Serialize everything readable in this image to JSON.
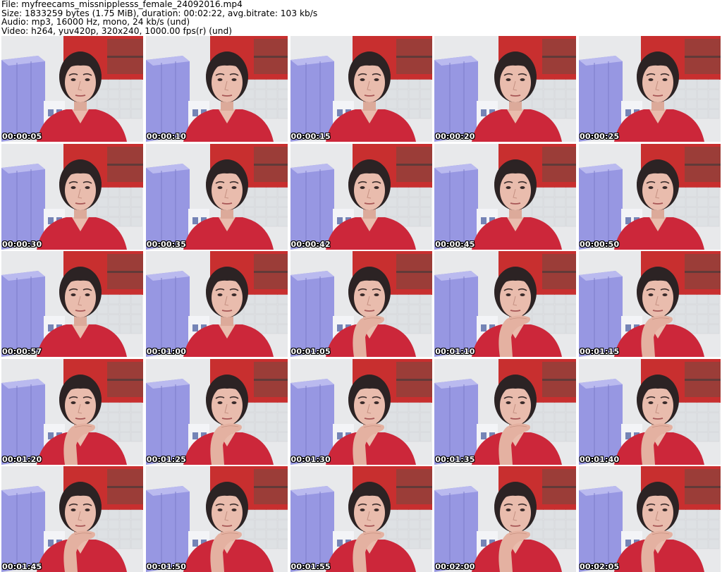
{
  "header": {
    "file_line": "File: myfreecams_missnipplesss_female_24092016.mp4",
    "size_line": "Size: 1833259 bytes (1.75 MiB), duration: 00:02:22, avg.bitrate: 103 kb/s",
    "audio_line": "Audio: mp3, 16000 Hz, mono, 24 kb/s (und)",
    "video_line": "Video: h264, yuv420p, 320x240, 1000.00 fps(r) (und)"
  },
  "thumbnails": [
    {
      "timestamp": "00:00:05",
      "pose": "neutral"
    },
    {
      "timestamp": "00:00:10",
      "pose": "neutral"
    },
    {
      "timestamp": "00:00:15",
      "pose": "neutral"
    },
    {
      "timestamp": "00:00:20",
      "pose": "neutral"
    },
    {
      "timestamp": "00:00:25",
      "pose": "neutral"
    },
    {
      "timestamp": "00:00:30",
      "pose": "neutral"
    },
    {
      "timestamp": "00:00:35",
      "pose": "neutral"
    },
    {
      "timestamp": "00:00:42",
      "pose": "neutral"
    },
    {
      "timestamp": "00:00:45",
      "pose": "neutral"
    },
    {
      "timestamp": "00:00:50",
      "pose": "neutral"
    },
    {
      "timestamp": "00:00:57",
      "pose": "neutral"
    },
    {
      "timestamp": "00:01:00",
      "pose": "neutral"
    },
    {
      "timestamp": "00:01:05",
      "pose": "hand-on-chin"
    },
    {
      "timestamp": "00:01:10",
      "pose": "hand-on-chin"
    },
    {
      "timestamp": "00:01:15",
      "pose": "hand-on-chin"
    },
    {
      "timestamp": "00:01:20",
      "pose": "hand-on-chin"
    },
    {
      "timestamp": "00:01:25",
      "pose": "hand-on-chin"
    },
    {
      "timestamp": "00:01:30",
      "pose": "hand-on-chin"
    },
    {
      "timestamp": "00:01:35",
      "pose": "hand-on-chin"
    },
    {
      "timestamp": "00:01:40",
      "pose": "hand-on-chin"
    },
    {
      "timestamp": "00:01:45",
      "pose": "hand-on-chin"
    },
    {
      "timestamp": "00:01:50",
      "pose": "hand-on-chin"
    },
    {
      "timestamp": "00:01:55",
      "pose": "hand-on-chin"
    },
    {
      "timestamp": "00:02:00",
      "pose": "hand-on-chin"
    },
    {
      "timestamp": "00:02:05",
      "pose": "hand-on-chin"
    }
  ],
  "colors": {
    "wall": "#e6e8ea",
    "cabinet": "#8f8fe0",
    "red_panel": "#c41e1e",
    "shirt": "#c8152a",
    "hair": "#1b1112",
    "skin": "#e8b7a7"
  }
}
